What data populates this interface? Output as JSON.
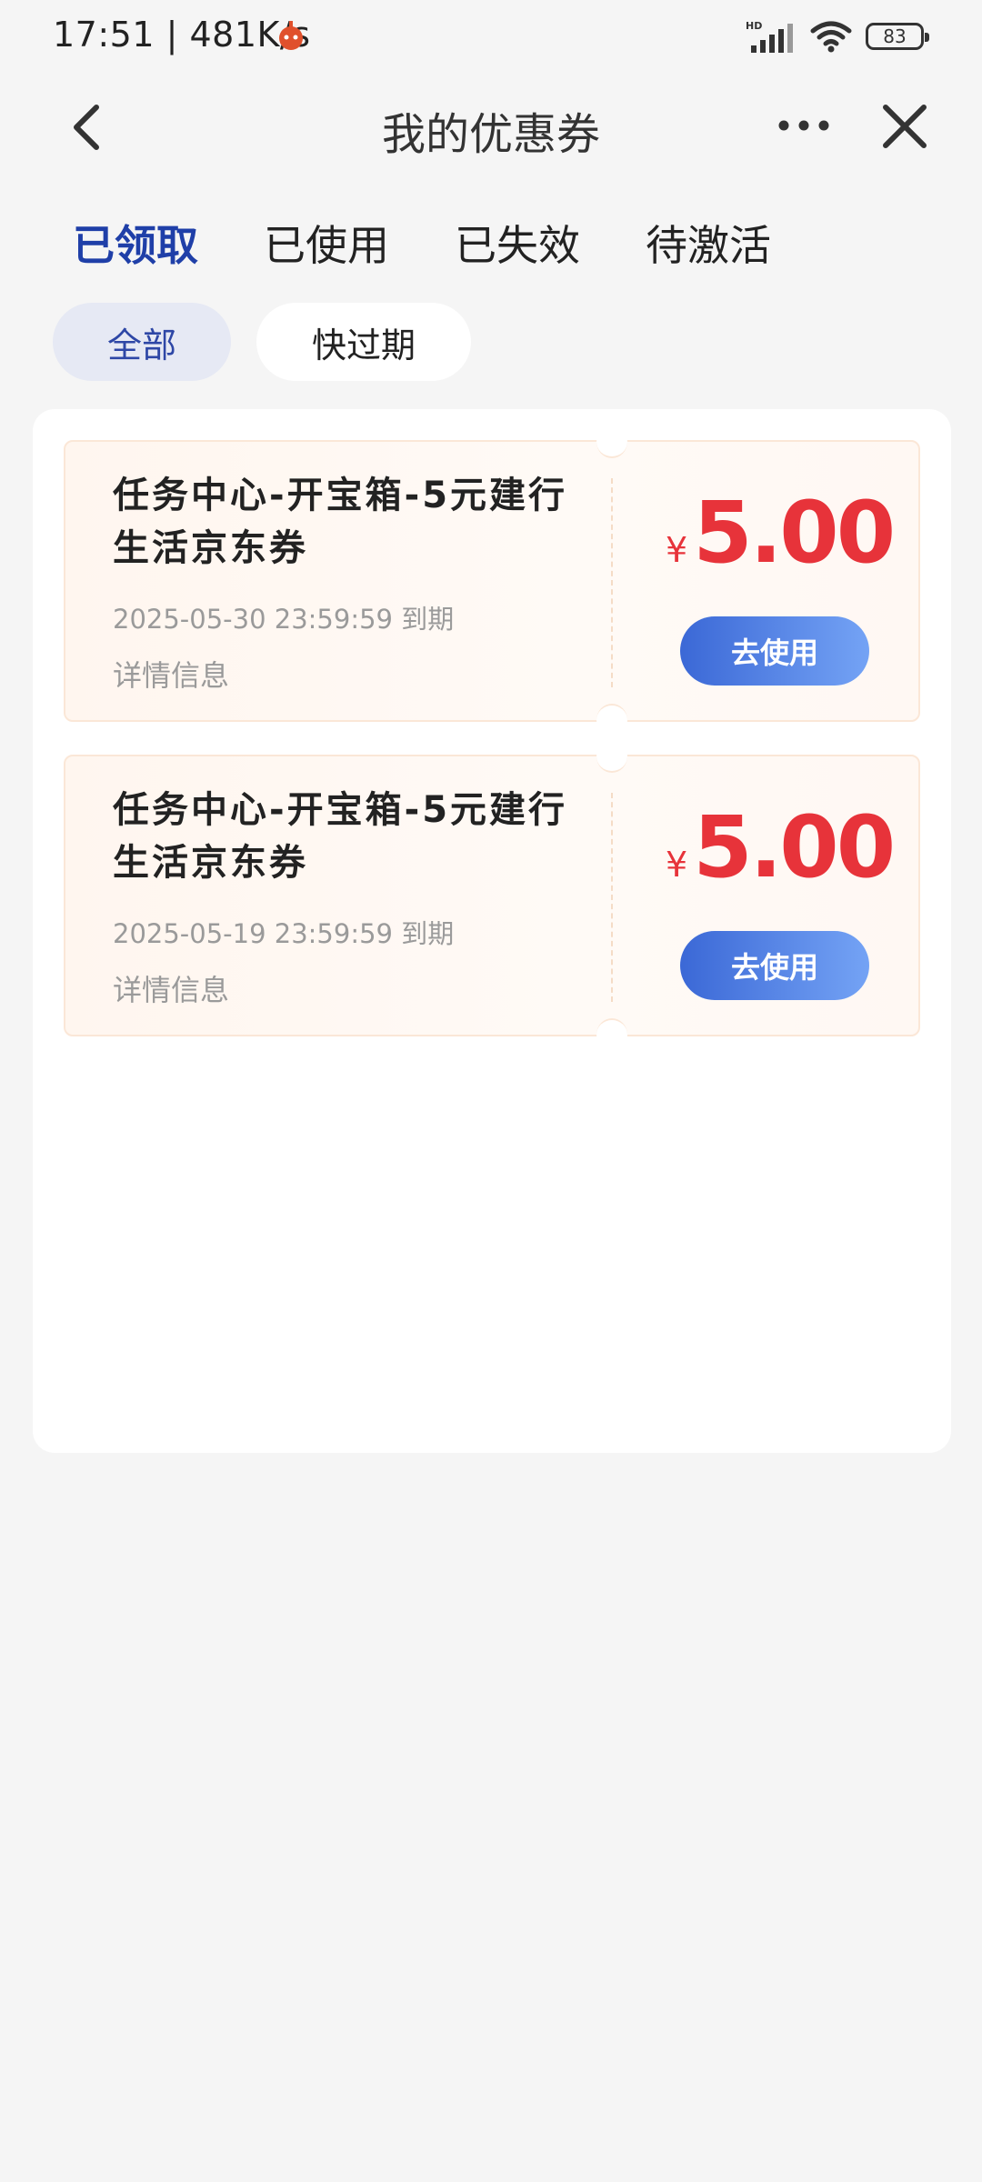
{
  "status_bar": {
    "time": "17:51",
    "speed": "481K/s",
    "battery": "83",
    "network": "HD"
  },
  "nav": {
    "title": "我的优惠券"
  },
  "tabs": [
    {
      "label": "已领取",
      "active": true
    },
    {
      "label": "已使用",
      "active": false
    },
    {
      "label": "已失效",
      "active": false
    },
    {
      "label": "待激活",
      "active": false
    }
  ],
  "filters": [
    {
      "label": "全部",
      "active": true
    },
    {
      "label": "快过期",
      "active": false
    }
  ],
  "coupons": [
    {
      "title": "任务中心-开宝箱-5元建行生活京东券",
      "expiry": "2025-05-30 23:59:59 到期",
      "detail": "详情信息",
      "currency": "¥",
      "amount": "5.00",
      "button": "去使用"
    },
    {
      "title": "任务中心-开宝箱-5元建行生活京东券",
      "expiry": "2025-05-19 23:59:59 到期",
      "detail": "详情信息",
      "currency": "¥",
      "amount": "5.00",
      "button": "去使用"
    }
  ],
  "colors": {
    "accent": "#1f3fa8",
    "price": "#e7333a",
    "button_start": "#3b68d6",
    "button_end": "#74a3f5"
  }
}
